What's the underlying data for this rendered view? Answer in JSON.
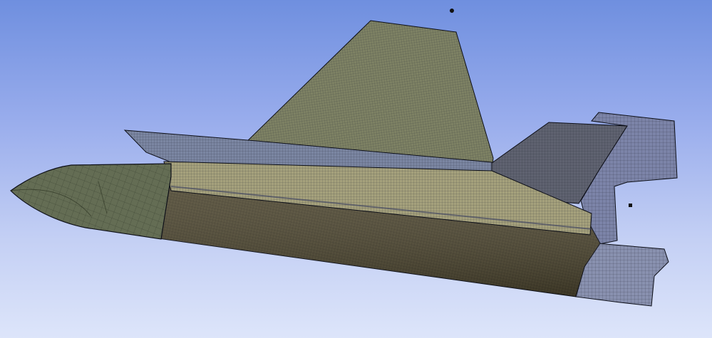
{
  "viewport": {
    "background_top": "#6f8fdf",
    "background_bottom": "#dde5fa"
  },
  "model": {
    "parts": [
      {
        "name": "fuselage-body",
        "color": "#514a33"
      },
      {
        "name": "fuselage-upper",
        "color": "#a5a17c"
      },
      {
        "name": "nose-cone",
        "color": "#646d54"
      },
      {
        "name": "vertical-fin",
        "color": "#7e8264"
      },
      {
        "name": "canard-wing",
        "color": "#7b86a2"
      },
      {
        "name": "rear-wing",
        "color": "#5f6270"
      },
      {
        "name": "tail-structure",
        "color": "#7c84a8"
      },
      {
        "name": "exhaust-nozzle",
        "color": "#8991af"
      }
    ],
    "mesh_line_color": "#1e2230",
    "outline_color": "#0d0f18",
    "marker_color": "#111111"
  }
}
